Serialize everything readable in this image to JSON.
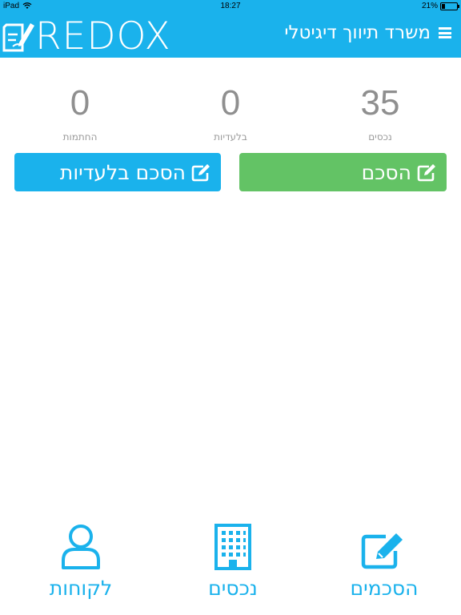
{
  "status_bar": {
    "device": "iPad",
    "time": "18:27",
    "battery": "21%"
  },
  "header": {
    "logo_text": "REDOX",
    "title": "משרד תיווך דיגיטלי",
    "menu_icon": "hamburger-menu-icon",
    "color": "#1ab2ec"
  },
  "stats": [
    {
      "value": "35",
      "label": "נכסים"
    },
    {
      "value": "0",
      "label": "בלעדיות"
    },
    {
      "value": "0",
      "label": "החתמות"
    }
  ],
  "buttons": {
    "agreement": {
      "label": "הסכם",
      "icon": "edit-icon",
      "color": "#63c365"
    },
    "exclusive_agreement": {
      "label": "הסכם בלעדיות",
      "icon": "edit-icon",
      "color": "#1ab2ec"
    }
  },
  "tabs": [
    {
      "label": "הסכמים",
      "icon": "edit-icon"
    },
    {
      "label": "נכסים",
      "icon": "building-icon"
    },
    {
      "label": "לקוחות",
      "icon": "user-icon"
    }
  ]
}
